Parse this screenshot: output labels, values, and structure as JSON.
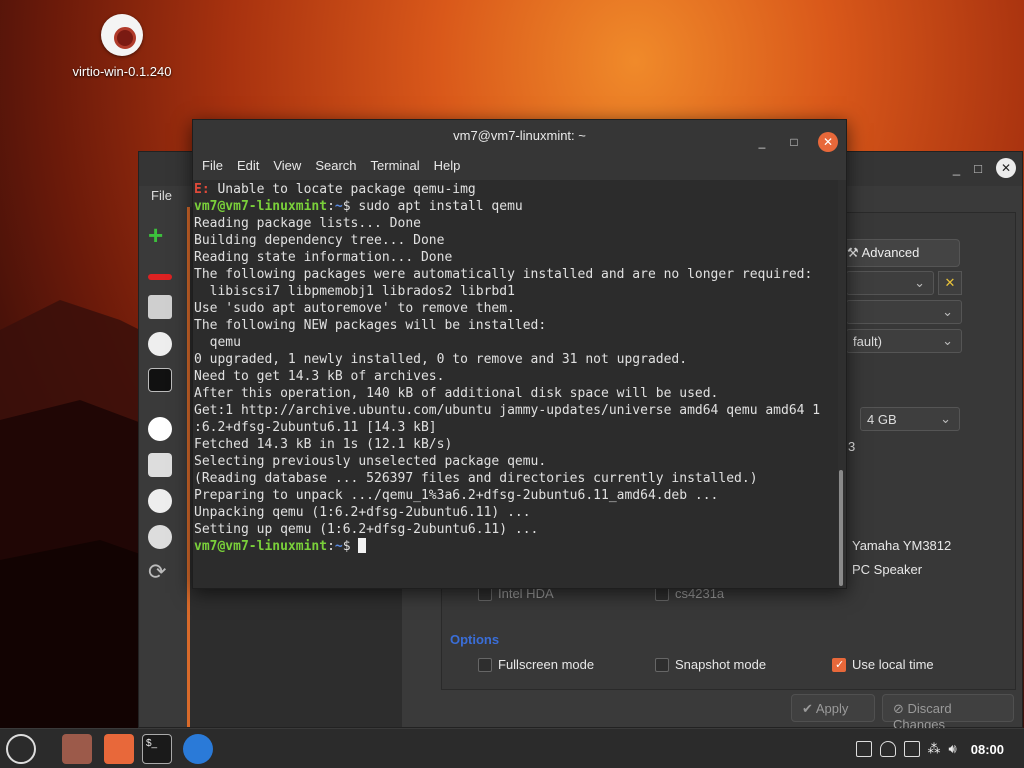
{
  "desktop": {
    "icons": [
      {
        "label": "virtio-win-0.1.240"
      }
    ]
  },
  "back_window": {
    "menu_file": "File",
    "advanced_label": "Advanced",
    "combo_default_text": "fault)",
    "memory_value": "4 GB",
    "memory_suffix": "3",
    "sound_items": [
      "Intel HDA",
      "cs4231a",
      "Yamaha YM3812",
      "PC Speaker"
    ],
    "options_label": "Options",
    "options": [
      {
        "label": "Fullscreen mode",
        "checked": false
      },
      {
        "label": "Snapshot mode",
        "checked": false
      },
      {
        "label": "Use local time",
        "checked": true
      }
    ],
    "apply_label": "Apply",
    "discard_label": "Discard Changes"
  },
  "terminal": {
    "title": "vm7@vm7-linuxmint: ~",
    "menu": [
      "File",
      "Edit",
      "View",
      "Search",
      "Terminal",
      "Help"
    ],
    "prompt_user": "vm7@vm7-linuxmint",
    "prompt_path": "~",
    "error_prefix": "E:",
    "error_text": " Unable to locate package qemu-img",
    "command": " sudo apt install qemu",
    "output": [
      "Reading package lists... Done",
      "Building dependency tree... Done",
      "Reading state information... Done",
      "The following packages were automatically installed and are no longer required:",
      "  libiscsi7 libpmemobj1 librados2 librbd1",
      "Use 'sudo apt autoremove' to remove them.",
      "The following NEW packages will be installed:",
      "  qemu",
      "0 upgraded, 1 newly installed, 0 to remove and 31 not upgraded.",
      "Need to get 14.3 kB of archives.",
      "After this operation, 140 kB of additional disk space will be used.",
      "Get:1 http://archive.ubuntu.com/ubuntu jammy-updates/universe amd64 qemu amd64 1",
      ":6.2+dfsg-2ubuntu6.11 [14.3 kB]",
      "Fetched 14.3 kB in 1s (12.1 kB/s)",
      "Selecting previously unselected package qemu.",
      "(Reading database ... 526397 files and directories currently installed.)",
      "Preparing to unpack .../qemu_1%3a6.2+dfsg-2ubuntu6.11_amd64.deb ...",
      "Unpacking qemu (1:6.2+dfsg-2ubuntu6.11) ...",
      "Setting up qemu (1:6.2+dfsg-2ubuntu6.11) ..."
    ]
  },
  "taskbar": {
    "clock": "08:00"
  },
  "colors": {
    "accent": "#e8683a",
    "prompt_green": "#7ad03a",
    "path_blue": "#5a8ae0",
    "error_red": "#e04a3a"
  }
}
